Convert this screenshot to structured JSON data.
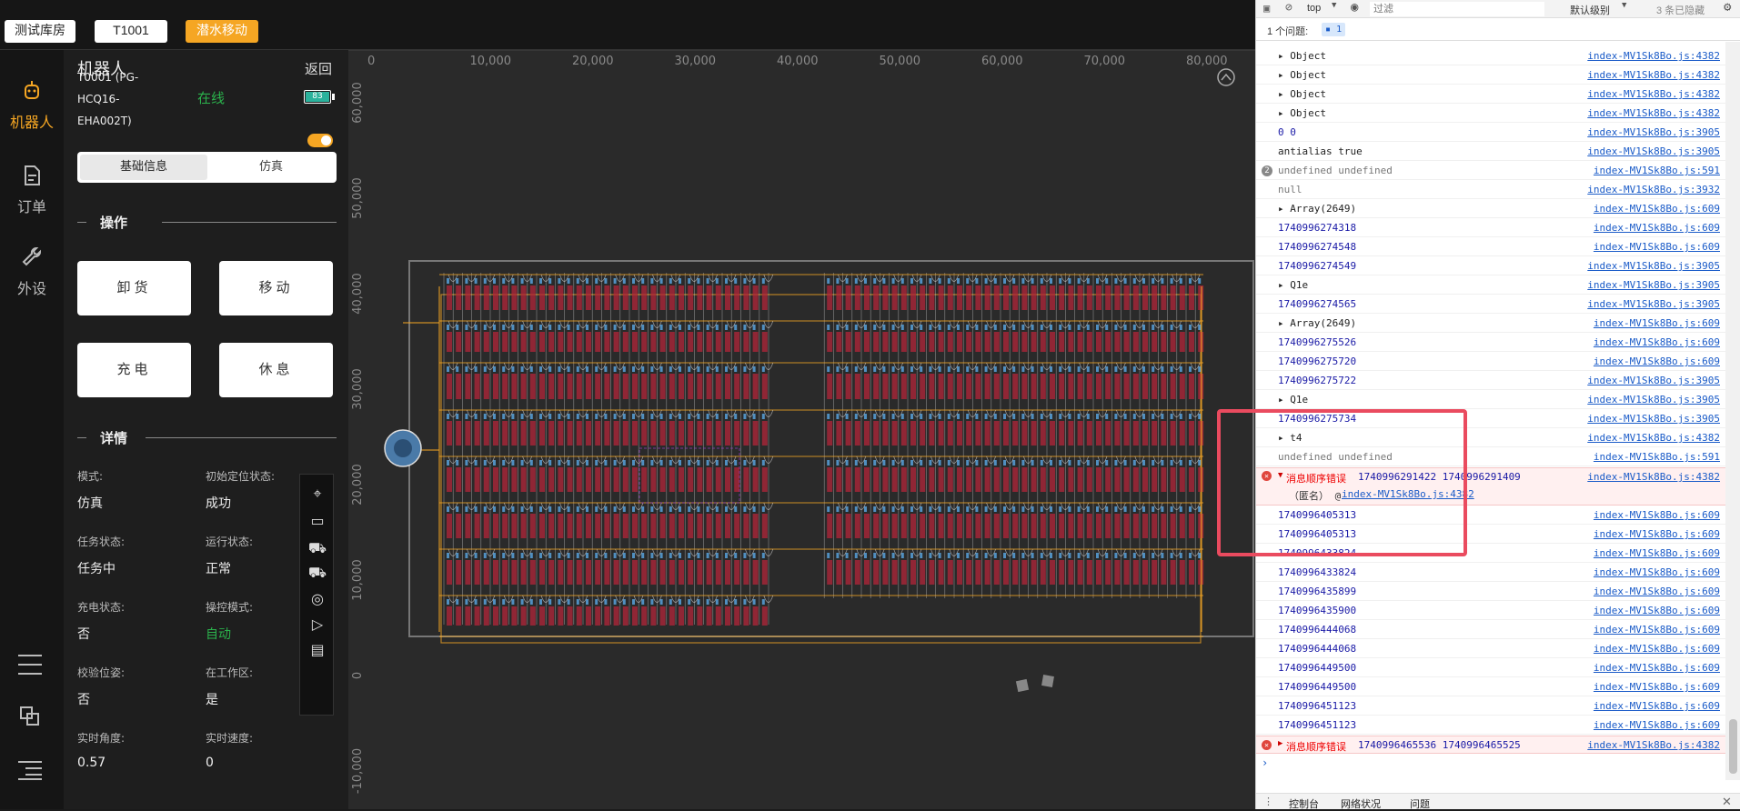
{
  "topbar": {
    "warehouse": "测试库房",
    "robot_code": "T1001",
    "mode_button": "潜水移动"
  },
  "nav": {
    "robot": "机器人",
    "order": "订单",
    "peripheral": "外设"
  },
  "panel": {
    "title": "机器人",
    "back": "返回",
    "robot_name_line1": "T0001",
    "robot_name_line1b": "(PG-",
    "robot_name_line2": "HCQ16-",
    "robot_name_line3": "EHA002T)",
    "status": "在线",
    "battery": "83",
    "tabs": [
      "基础信息",
      "仿真"
    ],
    "ops_heading": "操作",
    "ops_buttons": [
      "卸货",
      "移动",
      "充电",
      "休息"
    ],
    "details_heading": "详情",
    "details": [
      {
        "label": "模式:",
        "value": "仿真"
      },
      {
        "label": "初始定位状态:",
        "value": "成功"
      },
      {
        "label": "任务状态:",
        "value": "任务中"
      },
      {
        "label": "运行状态:",
        "value": "正常"
      },
      {
        "label": "充电状态:",
        "value": "否"
      },
      {
        "label": "操控模式:",
        "value": "自动"
      },
      {
        "label": "校验位姿:",
        "value": "否"
      },
      {
        "label": "在工作区:",
        "value": "是"
      },
      {
        "label": "实时角度:",
        "value": "0.57"
      },
      {
        "label": "实时速度:",
        "value": "0"
      }
    ]
  },
  "map": {
    "x_ticks": [
      "0",
      "10,000",
      "20,000",
      "30,000",
      "40,000",
      "50,000",
      "60,000",
      "70,000",
      "80,000"
    ],
    "y_ticks": [
      "60,000",
      "50,000",
      "40,000",
      "30,000",
      "20,000",
      "10,000",
      "0",
      "-10,000"
    ]
  },
  "devtools": {
    "context": "top",
    "filter_placeholder": "过滤",
    "level": "默认级别",
    "hidden_count": "3 条已隐藏",
    "issues": "1 个问题:",
    "issue_badge": "1",
    "rows": [
      {
        "msg": "▸ Object",
        "src": "index-MV1Sk8Bo.js:4382",
        "kind": "normal"
      },
      {
        "msg": "▸ Object",
        "src": "index-MV1Sk8Bo.js:4382",
        "kind": "normal"
      },
      {
        "msg": "▸ Object",
        "src": "index-MV1Sk8Bo.js:4382",
        "kind": "normal"
      },
      {
        "msg": "▸ Object",
        "src": "index-MV1Sk8Bo.js:4382",
        "kind": "normal"
      },
      {
        "msg": "0 0",
        "src": "index-MV1Sk8Bo.js:3905",
        "kind": "blue"
      },
      {
        "msg": "antialias true",
        "src": "index-MV1Sk8Bo.js:3905",
        "kind": "normal"
      },
      {
        "msg": "undefined undefined",
        "src": "index-MV1Sk8Bo.js:591",
        "kind": "gray",
        "badge": "2"
      },
      {
        "msg": "null",
        "src": "index-MV1Sk8Bo.js:3932",
        "kind": "gray"
      },
      {
        "msg": "▸ Array(2649)",
        "src": "index-MV1Sk8Bo.js:609",
        "kind": "normal"
      },
      {
        "msg": "1740996274318",
        "src": "index-MV1Sk8Bo.js:609",
        "kind": "blue"
      },
      {
        "msg": "1740996274548",
        "src": "index-MV1Sk8Bo.js:609",
        "kind": "blue"
      },
      {
        "msg": "1740996274549",
        "src": "index-MV1Sk8Bo.js:3905",
        "kind": "blue"
      },
      {
        "msg": "▸ Q1e",
        "src": "index-MV1Sk8Bo.js:3905",
        "kind": "normal"
      },
      {
        "msg": "1740996274565",
        "src": "index-MV1Sk8Bo.js:3905",
        "kind": "blue"
      },
      {
        "msg": "▸ Array(2649)",
        "src": "index-MV1Sk8Bo.js:609",
        "kind": "normal"
      },
      {
        "msg": "1740996275526",
        "src": "index-MV1Sk8Bo.js:609",
        "kind": "blue"
      },
      {
        "msg": "1740996275720",
        "src": "index-MV1Sk8Bo.js:609",
        "kind": "blue"
      },
      {
        "msg": "1740996275722",
        "src": "index-MV1Sk8Bo.js:3905",
        "kind": "blue"
      },
      {
        "msg": "▸ Q1e",
        "src": "index-MV1Sk8Bo.js:3905",
        "kind": "normal"
      },
      {
        "msg": "1740996275734",
        "src": "index-MV1Sk8Bo.js:3905",
        "kind": "blue"
      },
      {
        "msg": "▸ t4",
        "src": "index-MV1Sk8Bo.js:4382",
        "kind": "normal"
      },
      {
        "msg": "undefined undefined",
        "src": "index-MV1Sk8Bo.js:591",
        "kind": "gray"
      }
    ],
    "error_row": {
      "label": "消息顺序错误",
      "values": "1740996291422 1740996291409",
      "anon": "（匿名） @",
      "anon_link": "index-MV1Sk8Bo.js:4382",
      "src": "index-MV1Sk8Bo.js:4382"
    },
    "rows2": [
      {
        "msg": "1740996405313",
        "src": "index-MV1Sk8Bo.js:609"
      },
      {
        "msg": "1740996405313",
        "src": "index-MV1Sk8Bo.js:609"
      },
      {
        "msg": "1740996433824",
        "src": "index-MV1Sk8Bo.js:609"
      },
      {
        "msg": "1740996433824",
        "src": "index-MV1Sk8Bo.js:609"
      },
      {
        "msg": "1740996435899",
        "src": "index-MV1Sk8Bo.js:609"
      },
      {
        "msg": "1740996435900",
        "src": "index-MV1Sk8Bo.js:609"
      },
      {
        "msg": "1740996444068",
        "src": "index-MV1Sk8Bo.js:609"
      },
      {
        "msg": "1740996444068",
        "src": "index-MV1Sk8Bo.js:609"
      },
      {
        "msg": "1740996449500",
        "src": "index-MV1Sk8Bo.js:609"
      },
      {
        "msg": "1740996449500",
        "src": "index-MV1Sk8Bo.js:609"
      },
      {
        "msg": "1740996451123",
        "src": "index-MV1Sk8Bo.js:609"
      },
      {
        "msg": "1740996451123",
        "src": "index-MV1Sk8Bo.js:609"
      }
    ],
    "error_row2": {
      "label": "消息顺序错误",
      "values": "1740996465536 1740996465525",
      "src": "index-MV1Sk8Bo.js:4382"
    },
    "bottom_tabs": [
      "控制台",
      "网络状况",
      "问题"
    ]
  }
}
